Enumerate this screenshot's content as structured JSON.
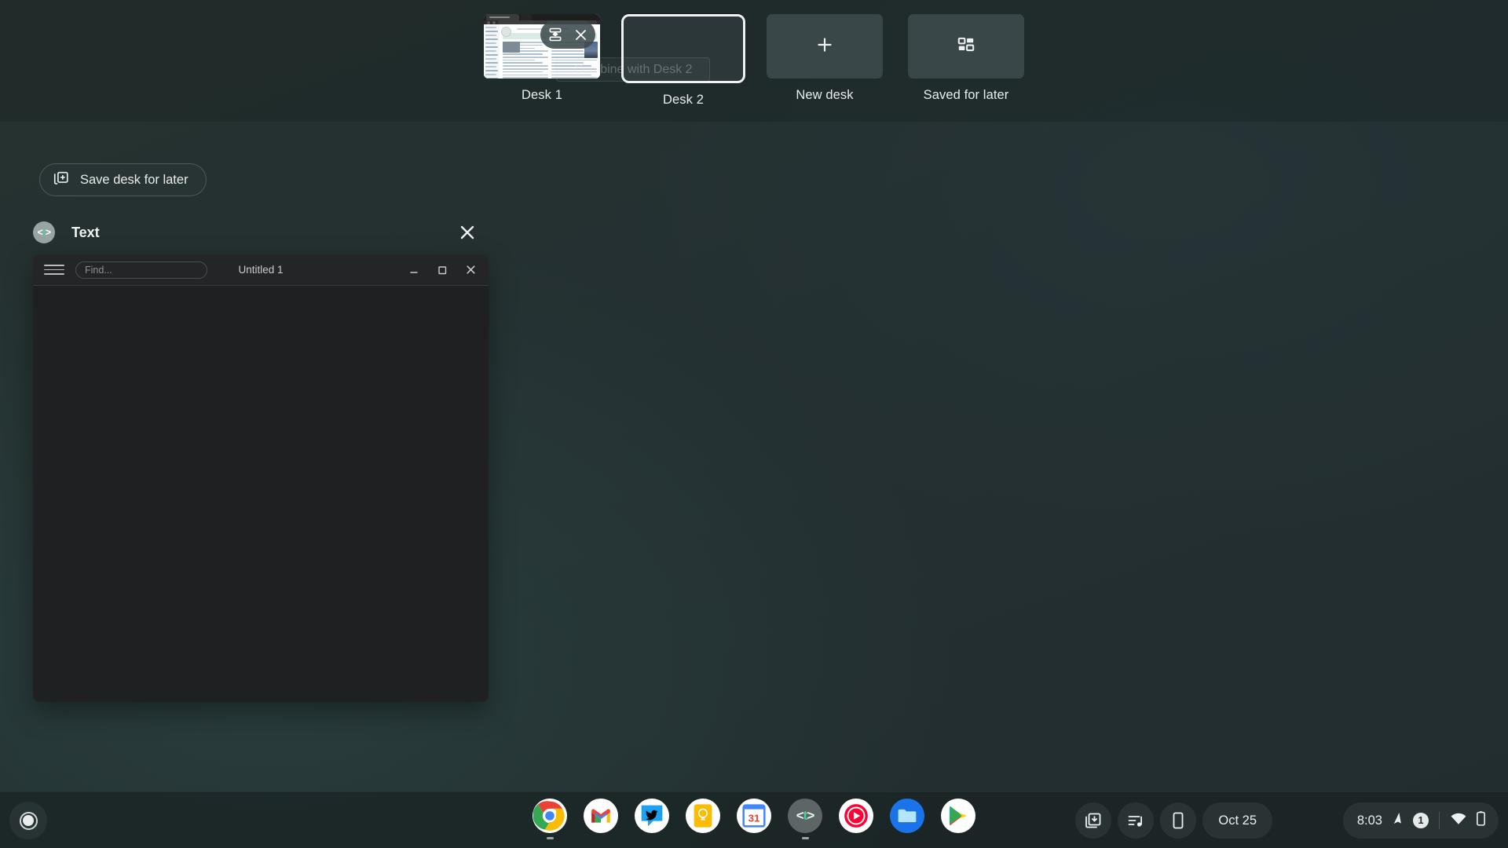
{
  "desk_bar": {
    "desks": [
      {
        "label": "Desk 1",
        "active": false,
        "has_thumbnail": true,
        "combine_icon": "combine-desks-icon",
        "close_icon": "close-icon"
      },
      {
        "label": "Desk 2",
        "active": true,
        "has_thumbnail": false
      }
    ],
    "new_desk": {
      "label": "New desk",
      "icon": "plus-icon"
    },
    "saved_for_later": {
      "label": "Saved for later",
      "icon": "saved-desks-icon"
    },
    "tooltip": "Combine with Desk 2"
  },
  "overview": {
    "save_desk": {
      "label": "Save desk for later",
      "icon": "save-desk-icon"
    },
    "item": {
      "app_icon": "text-app-icon",
      "app_icon_glyph_left": "<",
      "app_icon_glyph_mid": "t",
      "app_icon_glyph_right": ">",
      "title": "Text",
      "close_icon": "close-icon"
    }
  },
  "text_window": {
    "menu_icon": "hamburger-menu-icon",
    "find_placeholder": "Find...",
    "find_value": "",
    "document_title": "Untitled 1",
    "minimize_icon": "minimize-icon",
    "maximize_icon": "maximize-icon",
    "close_icon": "close-icon",
    "body_text": ""
  },
  "shelf": {
    "launcher": {
      "name": "launcher-button"
    },
    "apps": [
      {
        "name": "chrome",
        "label": "Chrome",
        "running": true
      },
      {
        "name": "gmail",
        "label": "Gmail",
        "running": false
      },
      {
        "name": "twitter",
        "label": "Twitter",
        "running": false
      },
      {
        "name": "keep",
        "label": "Keep",
        "running": false
      },
      {
        "name": "calendar",
        "label": "Calendar",
        "running": false,
        "day": "31"
      },
      {
        "name": "text",
        "label": "Text",
        "running": true
      },
      {
        "name": "youtube-music",
        "label": "YouTube Music",
        "running": false
      },
      {
        "name": "files",
        "label": "Files",
        "running": false
      },
      {
        "name": "play-store",
        "label": "Play Store",
        "running": false
      }
    ],
    "tray_buttons": [
      {
        "name": "screen-capture-icon"
      },
      {
        "name": "media-controls-icon"
      },
      {
        "name": "phone-hub-icon"
      }
    ],
    "date": "Oct 25",
    "status": {
      "time": "8:03",
      "cursor_icon": "pointer-icon",
      "notification_count": "1",
      "wifi_icon": "wifi-icon",
      "battery_icon": "battery-icon"
    }
  }
}
